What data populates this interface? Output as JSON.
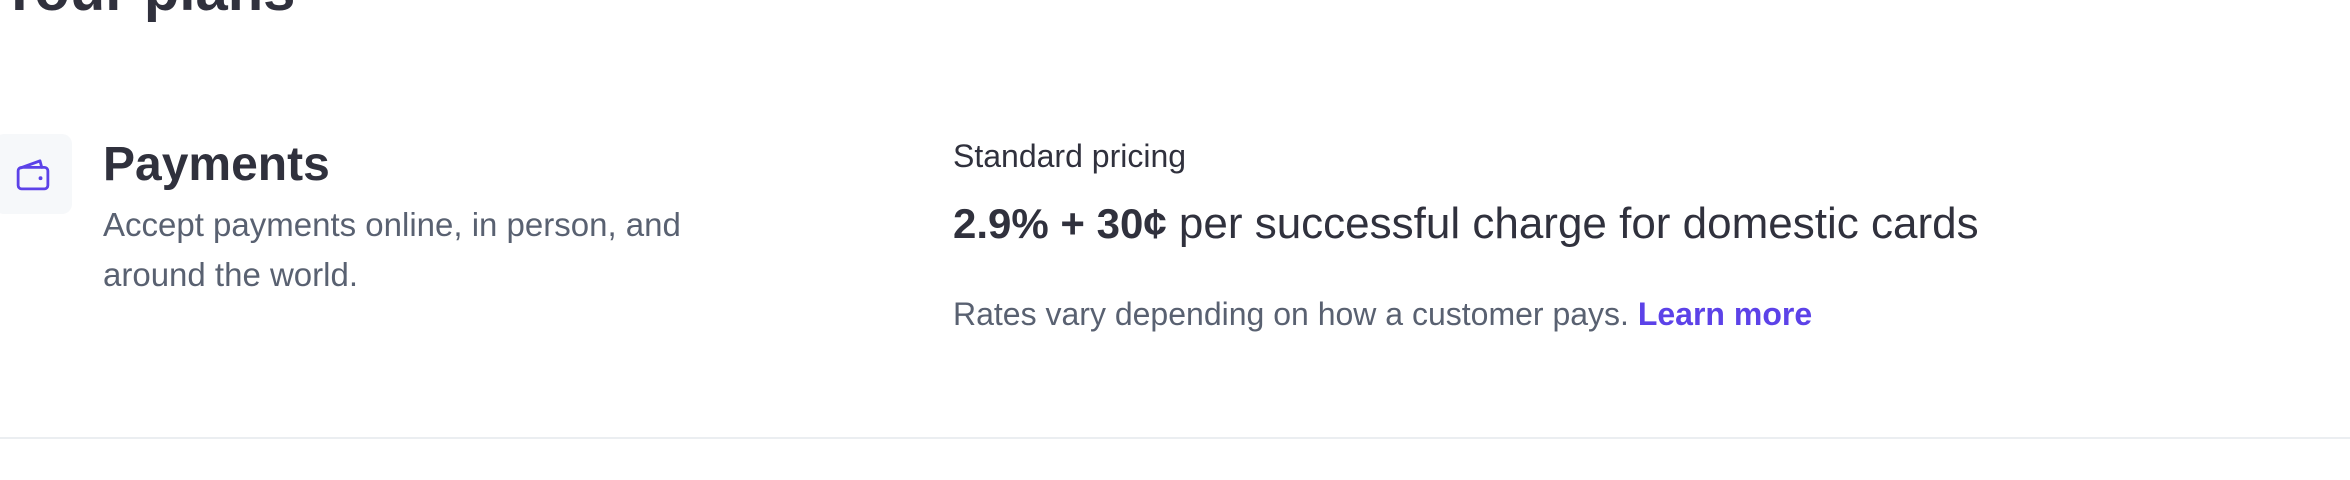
{
  "section": {
    "heading": "Your plans"
  },
  "product": {
    "icon": "wallet-icon",
    "name": "Payments",
    "description": "Accept payments online, in person, and around the world."
  },
  "pricing": {
    "label": "Standard pricing",
    "rate": "2.9% + 30¢",
    "rate_suffix": " per successful charge for domestic cards",
    "note": "Rates vary depending on how a customer pays.",
    "link_label": "Learn more"
  },
  "colors": {
    "accent": "#5c42e8",
    "text_primary": "#30313d",
    "text_secondary": "#596171",
    "icon_background": "#f6f8fa",
    "divider": "#ebeef1"
  }
}
